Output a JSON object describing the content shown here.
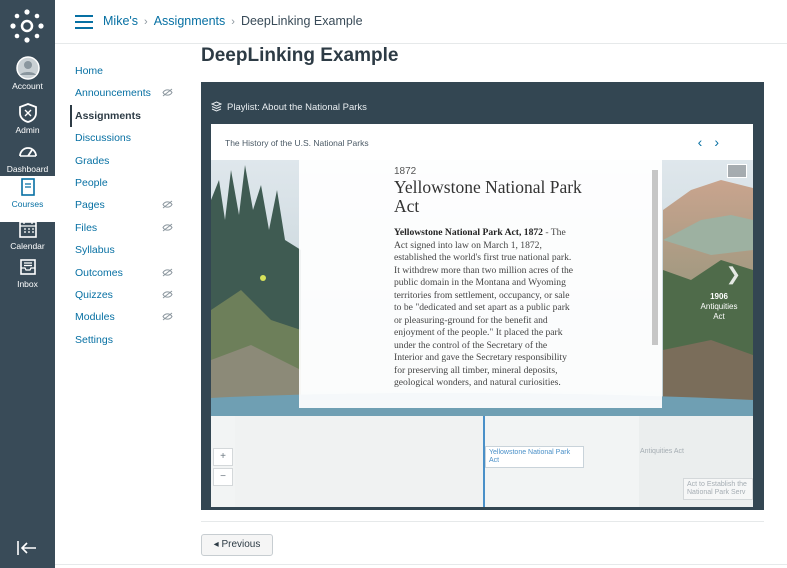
{
  "global_nav": {
    "items": [
      {
        "label": "Account",
        "icon": "avatar-icon"
      },
      {
        "label": "Admin",
        "icon": "shield-icon"
      },
      {
        "label": "Dashboard",
        "icon": "dashboard-icon"
      },
      {
        "label": "Courses",
        "icon": "book-icon",
        "active": true
      },
      {
        "label": "Calendar",
        "icon": "calendar-icon"
      },
      {
        "label": "Inbox",
        "icon": "inbox-icon"
      }
    ]
  },
  "breadcrumb": {
    "items": [
      "Mike's",
      "Assignments",
      "DeepLinking Example"
    ]
  },
  "course_nav": {
    "items": [
      {
        "label": "Home",
        "hidden": false
      },
      {
        "label": "Announcements",
        "hidden": true
      },
      {
        "label": "Assignments",
        "hidden": false,
        "active": true
      },
      {
        "label": "Discussions",
        "hidden": false
      },
      {
        "label": "Grades",
        "hidden": false
      },
      {
        "label": "People",
        "hidden": false
      },
      {
        "label": "Pages",
        "hidden": true
      },
      {
        "label": "Files",
        "hidden": true
      },
      {
        "label": "Syllabus",
        "hidden": false
      },
      {
        "label": "Outcomes",
        "hidden": true
      },
      {
        "label": "Quizzes",
        "hidden": true
      },
      {
        "label": "Modules",
        "hidden": true
      },
      {
        "label": "Settings",
        "hidden": false
      }
    ]
  },
  "page": {
    "title": "DeepLinking Example"
  },
  "player": {
    "playlist_title": "Playlist: About the National Parks",
    "story_title": "The History of the U.S. National Parks",
    "slide": {
      "year": "1872",
      "headline": "Yellowstone National Park Act",
      "body_bold": "Yellowstone National Park Act, 1872",
      "body_text": " - The Act signed into law on March 1, 1872, established the world's first true national park. It withdrew more than two million acres of the public domain in the Montana and Wyoming territories from settlement, occupancy, or sale to be \"dedicated and set apart as a public park or pleasuring-ground for the benefit and enjoyment of the people.\" It placed the park under the control of the Secretary of the Interior and gave the Secretary responsibility for preserving all timber, mineral deposits, geological wonders, and natural curiosities."
    },
    "next_slide": {
      "year": "1906",
      "title": "Antiquities Act"
    },
    "timeline": {
      "events": [
        {
          "label": "Yellowstone National Park Act",
          "state": "selected"
        },
        {
          "label": "Antiquities Act",
          "state": "dim"
        },
        {
          "label": "Act to Establish the National Park Serv",
          "state": "dim"
        }
      ],
      "zoom_in": "+",
      "zoom_out": "−"
    }
  },
  "footer": {
    "previous_label": "◂ Previous"
  },
  "colors": {
    "nav_bg": "#394b58",
    "link": "#0770a3",
    "player_bg": "#334652"
  }
}
